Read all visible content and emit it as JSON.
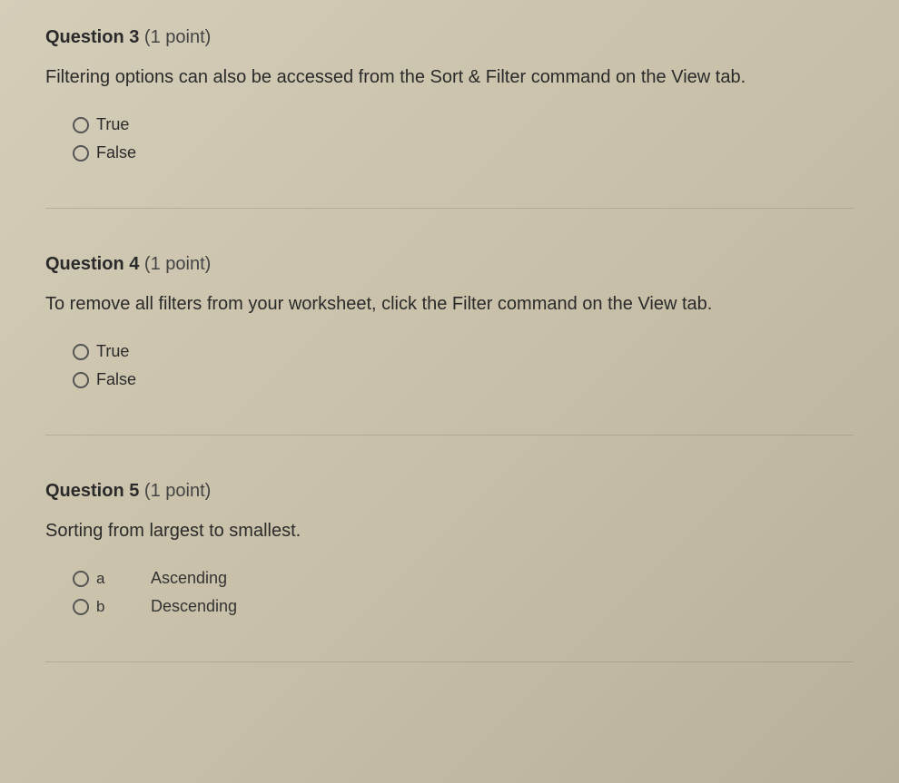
{
  "questions": [
    {
      "number": "Question 3",
      "points": "(1 point)",
      "text": "Filtering options can also be accessed from the Sort & Filter command on the View tab.",
      "options": [
        {
          "label": "True"
        },
        {
          "label": "False"
        }
      ]
    },
    {
      "number": "Question 4",
      "points": "(1 point)",
      "text": "To remove all filters from your worksheet, click the Filter command on the View tab.",
      "options": [
        {
          "label": "True"
        },
        {
          "label": "False"
        }
      ]
    },
    {
      "number": "Question 5",
      "points": "(1 point)",
      "text": "Sorting from largest to smallest.",
      "options": [
        {
          "key": "a",
          "label": "Ascending"
        },
        {
          "key": "b",
          "label": "Descending"
        }
      ]
    }
  ]
}
